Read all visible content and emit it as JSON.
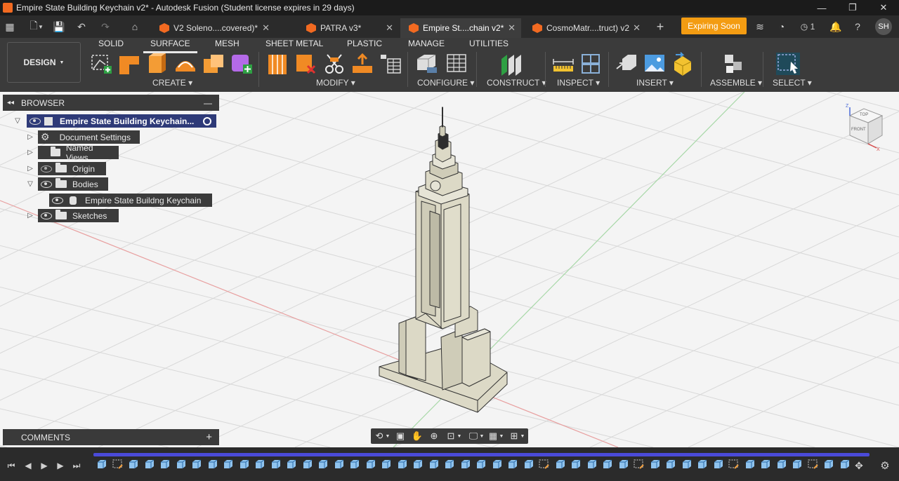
{
  "window": {
    "title": "Empire State Building Keychain v2* - Autodesk Fusion (Student license expires in 29 days)",
    "minimize": "—",
    "maximize": "❐",
    "close": "✕"
  },
  "tabs": [
    {
      "label": "V2 Soleno....covered)*",
      "active": false
    },
    {
      "label": "PATRA v3*",
      "active": false
    },
    {
      "label": "Empire St....chain v2*",
      "active": true
    },
    {
      "label": "CosmoMatr....truct) v2",
      "active": false
    }
  ],
  "header_right": {
    "expiring": "Expiring Soon",
    "notifications_count": "1",
    "user_initials": "SH"
  },
  "toolbar": {
    "workspace": "DESIGN",
    "tabs": [
      "SOLID",
      "SURFACE",
      "MESH",
      "SHEET METAL",
      "PLASTIC",
      "MANAGE",
      "UTILITIES"
    ],
    "active_tab": "SURFACE",
    "groups": [
      "CREATE",
      "MODIFY",
      "CONFIGURE",
      "CONSTRUCT",
      "INSPECT",
      "INSERT",
      "ASSEMBLE",
      "SELECT"
    ]
  },
  "browser": {
    "title": "BROWSER",
    "root": "Empire State Building Keychain...",
    "items": [
      {
        "label": "Document Settings",
        "icon": "gear-icon"
      },
      {
        "label": "Named Views",
        "icon": "folder-icon"
      },
      {
        "label": "Origin",
        "icon": "folder-icon"
      },
      {
        "label": "Bodies",
        "icon": "folder-icon"
      },
      {
        "label": "Empire State Buildng Keychain",
        "icon": "body-icon"
      },
      {
        "label": "Sketches",
        "icon": "folder-icon"
      }
    ]
  },
  "comments": {
    "title": "COMMENTS"
  },
  "viewcube": {
    "top": "TOP",
    "front": "FRONT",
    "axis_x": "X",
    "axis_z": "Z"
  },
  "colors": {
    "accent": "#f39c12",
    "tab_orange": "#f26a21",
    "selection_blue": "#2e3a78",
    "model_face": "#dcd9c6",
    "timeline_track": "#4a4ad8"
  }
}
